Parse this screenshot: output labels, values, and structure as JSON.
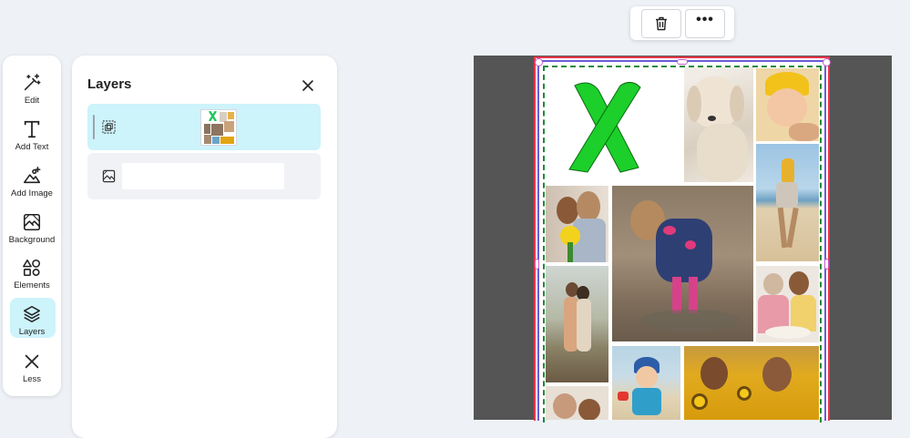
{
  "toolbar": {
    "items": [
      {
        "label": "Edit",
        "icon": "magic-wand-icon"
      },
      {
        "label": "Add Text",
        "icon": "text-t-icon"
      },
      {
        "label": "Add Image",
        "icon": "add-image-icon"
      },
      {
        "label": "Background",
        "icon": "background-icon"
      },
      {
        "label": "Elements",
        "icon": "shapes-icon"
      },
      {
        "label": "Layers",
        "icon": "layers-icon"
      },
      {
        "label": "Less",
        "icon": "close-x-icon"
      }
    ],
    "active": "Layers",
    "active_color": "#cdf3fb"
  },
  "layers_panel": {
    "title": "Layers",
    "close_icon": "close-icon",
    "rows": [
      {
        "type": "group",
        "icon": "group-icon",
        "selected": true
      },
      {
        "type": "image",
        "icon": "image-icon",
        "selected": false,
        "name_value": ""
      }
    ]
  },
  "float_toolbar": {
    "buttons": [
      {
        "icon": "trash-icon"
      },
      {
        "icon": "more-horizontal-icon",
        "label": "•••"
      }
    ]
  },
  "canvas": {
    "background_color": "#555555",
    "selection_colors": {
      "outer": "#e93649",
      "inner": "#6c5bd6",
      "dashed": "#1e8a3a"
    },
    "photos": [
      {
        "name": "green-ribbon-photo"
      },
      {
        "name": "white-dog-photo"
      },
      {
        "name": "baby-yellow-hat-photo"
      },
      {
        "name": "kid-shoulders-beach-photo"
      },
      {
        "name": "mother-daughter-flowers-photo"
      },
      {
        "name": "girl-puddle-photo"
      },
      {
        "name": "couple-pier-photo"
      },
      {
        "name": "grandma-baking-photo"
      },
      {
        "name": "boy-beach-photo"
      },
      {
        "name": "sunflower-girls-photo"
      },
      {
        "name": "kids-smiling-photo"
      }
    ]
  }
}
